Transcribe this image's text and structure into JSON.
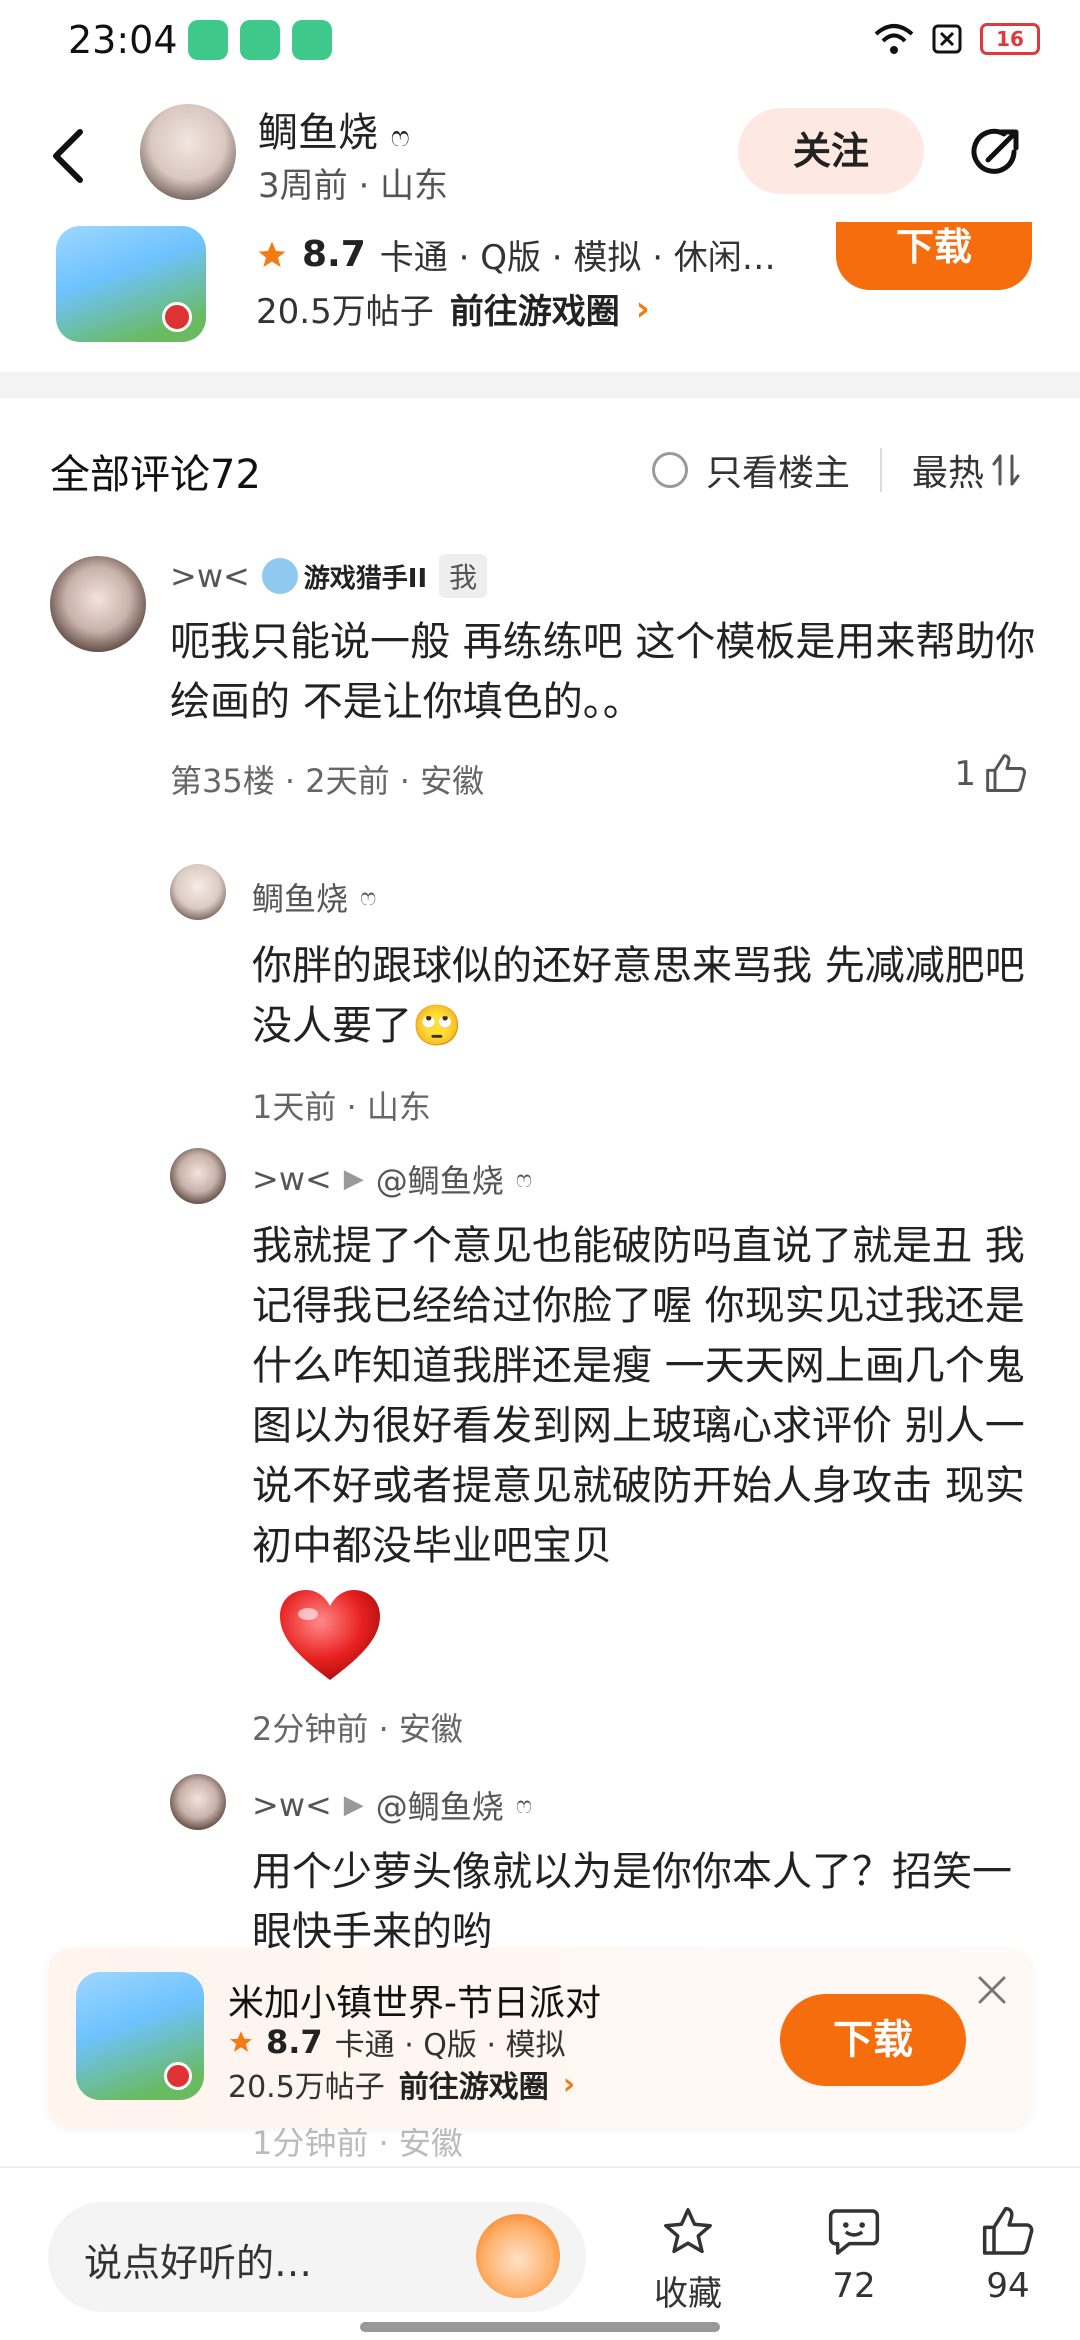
{
  "status_bar": {
    "time": "23:04",
    "battery": "16"
  },
  "header": {
    "username": "鲷鱼烧",
    "user_mark": "ෆ",
    "subtitle": "3周前 · 山东",
    "follow_label": "关注"
  },
  "game_card_top": {
    "rating": "8.7",
    "tags": "卡通 · Q版 · 模拟 · 休闲…",
    "posts": "20.5万帖子",
    "goto_label": "前往游戏圈",
    "download_label": "下载"
  },
  "comments_header": {
    "title": "全部评论72",
    "op_only_label": "只看楼主",
    "sort_label": "最热"
  },
  "comments": [
    {
      "name": ">w<",
      "badge": "游戏猎手II",
      "me_tag": "我",
      "text": "呃我只能说一般 再练练吧 这个模板是用来帮助你绘画的 不是让你填色的。。",
      "meta": "第35楼 · 2天前 · 安徽",
      "likes": "1"
    },
    {
      "name": "鲷鱼烧",
      "name_mark": "ෆ",
      "text": "你胖的跟球似的还好意思来骂我 先减减肥吧 没人要了🙄",
      "meta": "1天前 · 山东"
    },
    {
      "name": ">w<",
      "reply_to": "@鲷鱼烧",
      "reply_mark": "ෆ",
      "text": "我就提了个意见也能破防吗直说了就是丑 我记得我已经给过你脸了喔 你现实见过我还是什么咋知道我胖还是瘦 一天天网上画几个鬼图以为很好看发到网上玻璃心求评价 别人一说不好或者提意见就破防开始人身攻击 现实初中都没毕业吧宝贝",
      "meta": "2分钟前 · 安徽"
    },
    {
      "name": ">w<",
      "reply_to": "@鲷鱼烧",
      "reply_mark": "ෆ",
      "text": "用个少萝头像就以为是你你本人了？招笑一眼快手来的哟",
      "meta": "1分钟前 · 安徽"
    }
  ],
  "game_banner": {
    "title": "米加小镇世界-节日派对",
    "rating": "8.7",
    "tags": "卡通 · Q版 · 模拟",
    "posts": "20.5万帖子",
    "goto_label": "前往游戏圈",
    "download_label": "下载"
  },
  "bottom_bar": {
    "input_placeholder": "说点好听的…",
    "favorite_label": "收藏",
    "comment_count": "72",
    "like_count": "94"
  },
  "colors": {
    "accent": "#f66d0e",
    "follow_bg": "#fde9e2",
    "battery_low": "#e0383f"
  }
}
